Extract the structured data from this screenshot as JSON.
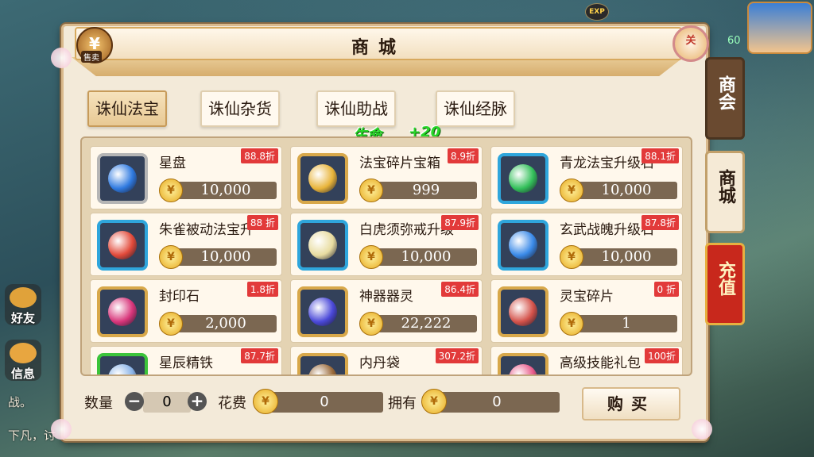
{
  "hud": {
    "exp_label": "EXP",
    "level": "60",
    "side_buttons": [
      {
        "label": "好友",
        "icon": "friends-icon"
      },
      {
        "label": "信息",
        "icon": "message-icon"
      }
    ],
    "chat_lines": [
      "战。",
      "下凡，讨"
    ]
  },
  "shop": {
    "title": "商城",
    "medal_text": "¥",
    "medal_tag": "售卖",
    "close_label": "关",
    "tabs": [
      "诛仙法宝",
      "诛仙杂货",
      "诛仙助战",
      "诛仙经脉"
    ],
    "active_tab": 0,
    "buff": {
      "text": "生命",
      "value": "+20"
    },
    "items": [
      {
        "name": "星盘",
        "discount": "88.8折",
        "price": "10,000",
        "frame": "gray",
        "gem": "#2f7ae0",
        "icon": "star-plate-icon"
      },
      {
        "name": "法宝碎片宝箱",
        "discount": "8.9折",
        "price": "999",
        "frame": "gold",
        "gem": "#e8b43a",
        "icon": "gift-box-icon"
      },
      {
        "name": "青龙法宝升级石",
        "discount": "88.1折",
        "price": "10,000",
        "frame": "blue",
        "gem": "#33c05a",
        "icon": "green-orb-icon"
      },
      {
        "name": "朱雀被动法宝升",
        "discount": "88 折",
        "price": "10,000",
        "frame": "blue",
        "gem": "#e24a3a",
        "icon": "red-orb-icon"
      },
      {
        "name": "白虎须弥戒升级",
        "discount": "87.9折",
        "price": "10,000",
        "frame": "blue",
        "gem": "#e8dca0",
        "icon": "white-orb-icon"
      },
      {
        "name": "玄武战魄升级石",
        "discount": "87.8折",
        "price": "10,000",
        "frame": "blue",
        "gem": "#3a8ae8",
        "icon": "blue-orb-icon"
      },
      {
        "name": "封印石",
        "discount": "1.8折",
        "price": "2,000",
        "frame": "gold",
        "gem": "#d8357a",
        "icon": "seal-stone-icon"
      },
      {
        "name": "神器器灵",
        "discount": "86.4折",
        "price": "22,222",
        "frame": "gold",
        "gem": "#4a48d8",
        "icon": "spirit-orb-icon"
      },
      {
        "name": "灵宝碎片",
        "discount": "0 折",
        "price": "1",
        "frame": "gold",
        "gem": "#d4524a",
        "icon": "fragment-icon"
      },
      {
        "name": "星辰精铁",
        "discount": "87.7折",
        "price": "",
        "frame": "green",
        "gem": "#8ab4e8",
        "icon": "iron-icon"
      },
      {
        "name": "内丹袋",
        "discount": "307.2折",
        "price": "",
        "frame": "gold",
        "gem": "#9a6a3a",
        "icon": "pouch-icon"
      },
      {
        "name": "高级技能礼包",
        "discount": "100折",
        "price": "",
        "frame": "gold",
        "gem": "#e85a8a",
        "icon": "skill-gift-icon"
      }
    ],
    "bottom": {
      "quantity_label": "数量",
      "quantity": "0",
      "cost_label": "花费",
      "cost": "0",
      "own_label": "拥有",
      "own": "0",
      "buy_label": "购买"
    },
    "side_tabs": [
      "商会",
      "商城",
      "充值"
    ]
  }
}
